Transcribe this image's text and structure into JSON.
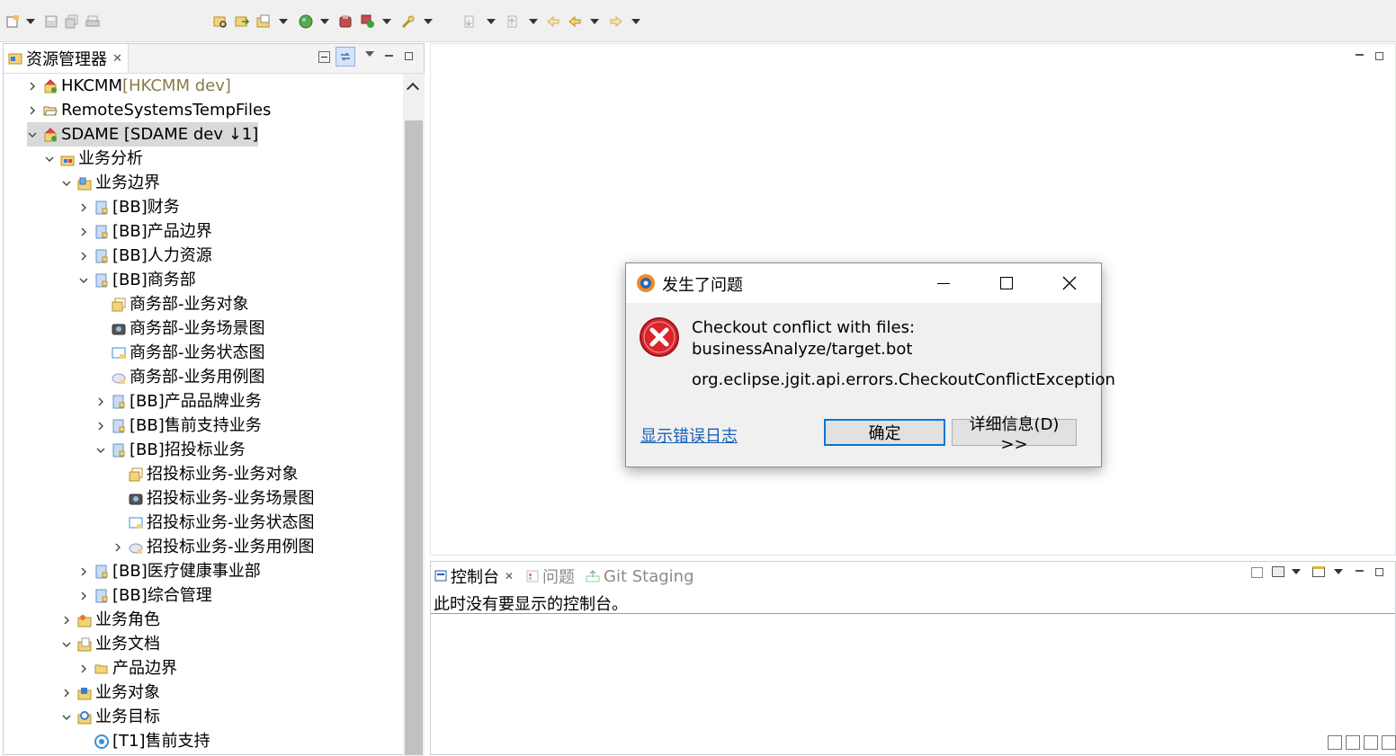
{
  "toolbar": {
    "icons": [
      "new-wizard-icon",
      "save-icon",
      "save-all-icon",
      "print-icon",
      "open-type-icon",
      "open-resource-icon",
      "new-folder-icon",
      "globe-icon",
      "bug-icon",
      "run-icon",
      "search-icon",
      "next-annotation-icon",
      "prev-annotation-icon",
      "last-edit-icon",
      "back-icon",
      "forward-icon"
    ]
  },
  "explorer": {
    "tab_label": "资源管理器",
    "items": [
      {
        "label": "HKCMM",
        "suffix": " [HKCMM dev]",
        "depth": 0,
        "expanded": false,
        "icon": "project-icon"
      },
      {
        "label": "RemoteSystemsTempFiles",
        "suffix": "",
        "depth": 0,
        "expanded": false,
        "icon": "folder-open-icon"
      },
      {
        "label": "SDAME [SDAME dev ↓1]",
        "suffix": "",
        "depth": 0,
        "expanded": true,
        "icon": "project-icon",
        "selected": true
      },
      {
        "label": "业务分析",
        "suffix": "",
        "depth": 1,
        "expanded": true,
        "icon": "package-icon"
      },
      {
        "label": "业务边界",
        "suffix": "",
        "depth": 2,
        "expanded": true,
        "icon": "boundary-icon"
      },
      {
        "label": "[BB]财务",
        "suffix": "",
        "depth": 3,
        "expanded": false,
        "icon": "bb-icon"
      },
      {
        "label": "[BB]产品边界",
        "suffix": "",
        "depth": 3,
        "expanded": false,
        "icon": "bb-icon"
      },
      {
        "label": "[BB]人力资源",
        "suffix": "",
        "depth": 3,
        "expanded": false,
        "icon": "bb-icon"
      },
      {
        "label": "[BB]商务部",
        "suffix": "",
        "depth": 3,
        "expanded": true,
        "icon": "bb-icon"
      },
      {
        "label": "商务部-业务对象",
        "suffix": "",
        "depth": 4,
        "leaf": true,
        "icon": "object-diagram-icon"
      },
      {
        "label": "商务部-业务场景图",
        "suffix": "",
        "depth": 4,
        "leaf": true,
        "icon": "scene-diagram-icon"
      },
      {
        "label": "商务部-业务状态图",
        "suffix": "",
        "depth": 4,
        "leaf": true,
        "icon": "state-diagram-icon"
      },
      {
        "label": "商务部-业务用例图",
        "suffix": "",
        "depth": 4,
        "leaf": true,
        "icon": "usecase-diagram-icon"
      },
      {
        "label": "[BB]产品品牌业务",
        "suffix": "",
        "depth": 4,
        "expanded": false,
        "icon": "bb-icon"
      },
      {
        "label": "[BB]售前支持业务",
        "suffix": "",
        "depth": 4,
        "expanded": false,
        "icon": "bb-icon"
      },
      {
        "label": "[BB]招投标业务",
        "suffix": "",
        "depth": 4,
        "expanded": true,
        "icon": "bb-icon"
      },
      {
        "label": "招投标业务-业务对象",
        "suffix": "",
        "depth": 5,
        "leaf": true,
        "icon": "object-diagram-icon"
      },
      {
        "label": "招投标业务-业务场景图",
        "suffix": "",
        "depth": 5,
        "leaf": true,
        "icon": "scene-diagram-icon"
      },
      {
        "label": "招投标业务-业务状态图",
        "suffix": "",
        "depth": 5,
        "leaf": true,
        "icon": "state-diagram-icon"
      },
      {
        "label": "招投标业务-业务用例图",
        "suffix": "",
        "depth": 5,
        "expanded": false,
        "icon": "usecase-diagram-icon"
      },
      {
        "label": "[BB]医疗健康事业部",
        "suffix": "",
        "depth": 3,
        "expanded": false,
        "icon": "bb-icon"
      },
      {
        "label": "[BB]综合管理",
        "suffix": "",
        "depth": 3,
        "expanded": false,
        "icon": "bb-icon"
      },
      {
        "label": "业务角色",
        "suffix": "",
        "depth": 2,
        "expanded": false,
        "icon": "role-folder-icon"
      },
      {
        "label": "业务文档",
        "suffix": "",
        "depth": 2,
        "expanded": true,
        "icon": "doc-folder-icon"
      },
      {
        "label": "产品边界",
        "suffix": "",
        "depth": 3,
        "expanded": false,
        "icon": "folder-icon"
      },
      {
        "label": "业务对象",
        "suffix": "",
        "depth": 2,
        "expanded": false,
        "icon": "object-folder-icon"
      },
      {
        "label": "业务目标",
        "suffix": "",
        "depth": 2,
        "expanded": true,
        "icon": "target-folder-icon"
      },
      {
        "label": "[T1]售前支持",
        "suffix": "",
        "depth": 3,
        "leaf": true,
        "icon": "target-icon"
      }
    ]
  },
  "console": {
    "tabs": [
      {
        "label": "控制台",
        "active": true,
        "icon": "console-icon"
      },
      {
        "label": "问题",
        "active": false,
        "icon": "problems-icon"
      },
      {
        "label": "Git Staging",
        "active": false,
        "icon": "git-staging-icon"
      }
    ],
    "message": "此时没有要显示的控制台。"
  },
  "dialog": {
    "title": "发生了问题",
    "message_line1": "Checkout conflict with files:",
    "message_line2": "businessAnalyze/target.bot",
    "exception": "org.eclipse.jgit.api.errors.CheckoutConflictException",
    "link": "显示错误日志",
    "ok_label": "确定",
    "details_label": "详细信息(D) >>"
  },
  "colors": {
    "error_red": "#d9262c",
    "link_blue": "#1a5fb4",
    "focus_blue": "#0078d7"
  }
}
